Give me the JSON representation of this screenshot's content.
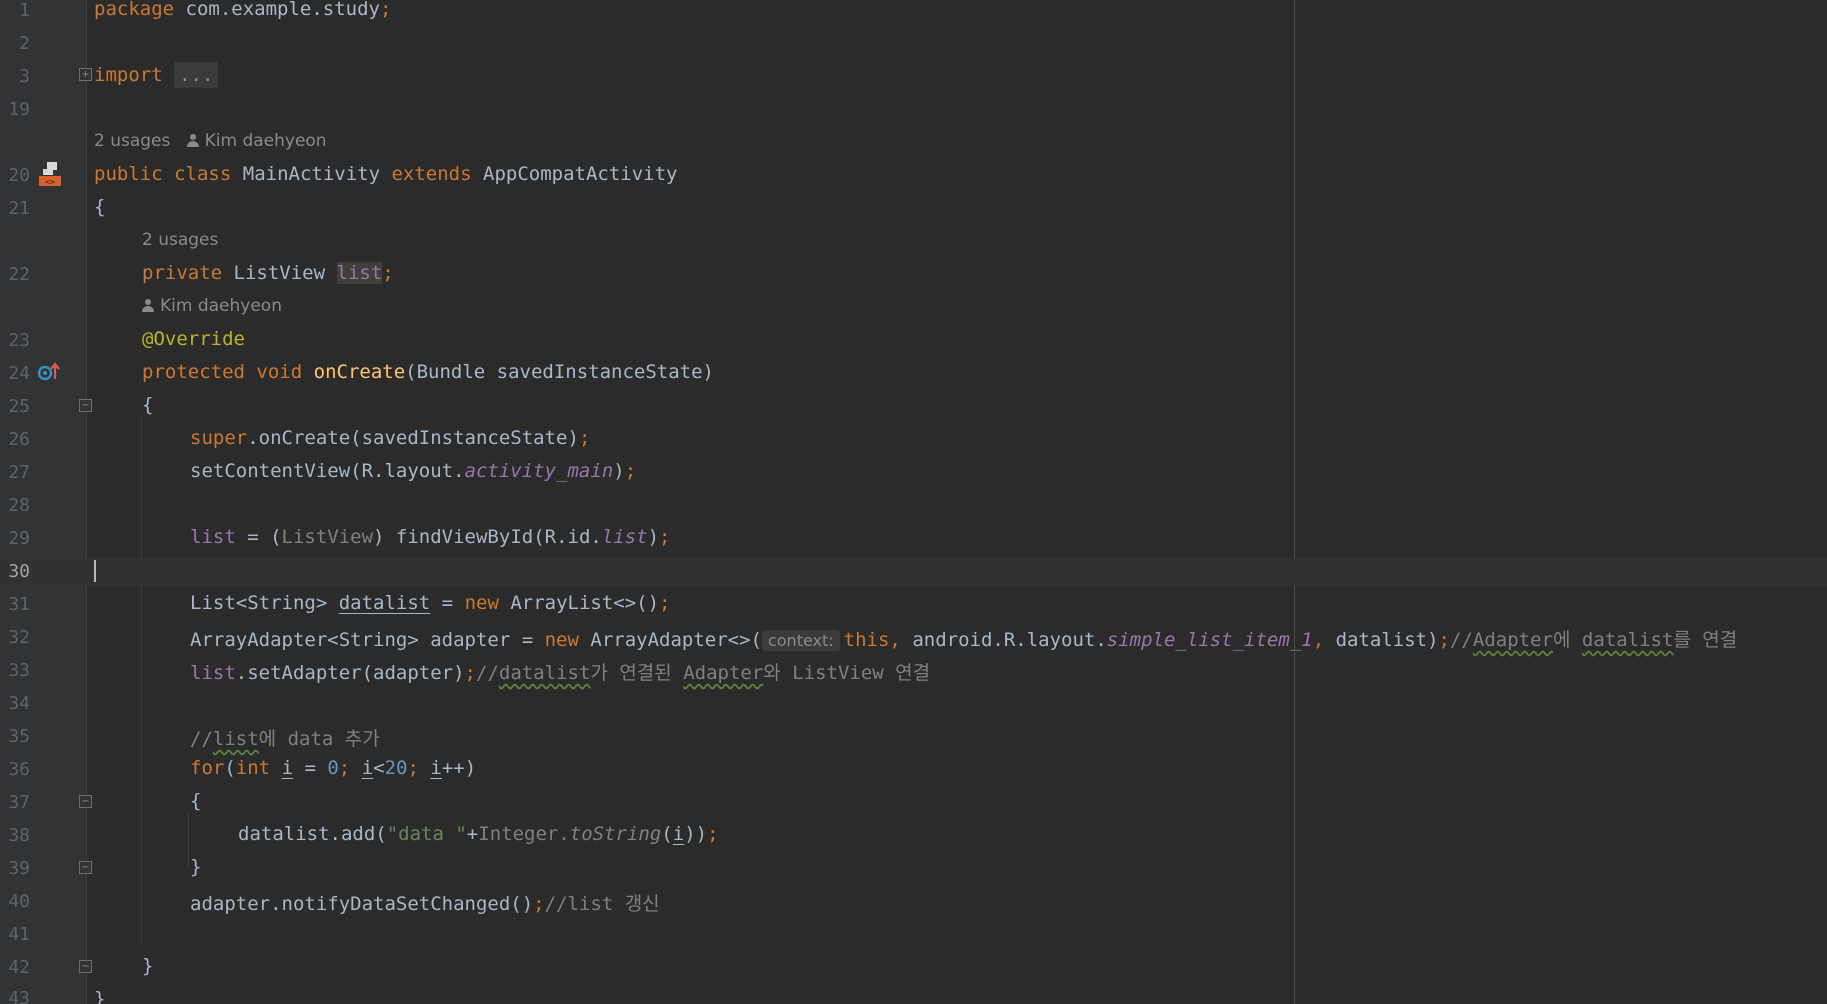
{
  "colors": {
    "background": "#2b2b2b",
    "keyword": "#cc7832",
    "method": "#ffc66d",
    "annotation": "#bbb529",
    "field": "#9876aa",
    "number": "#6897bb",
    "string": "#6a8759",
    "comment": "#808080"
  },
  "gutter": {
    "current_line": "30",
    "line_numbers": [
      "1",
      "2",
      "3",
      "19",
      "20",
      "21",
      "22",
      "23",
      "24",
      "25",
      "26",
      "27",
      "28",
      "29",
      "30",
      "31",
      "32",
      "33",
      "34",
      "35",
      "36",
      "37",
      "38",
      "39",
      "40",
      "41",
      "42",
      "43"
    ],
    "icons": [
      "layout-file-icon",
      "override-method-icon"
    ]
  },
  "hints": {
    "usages_class": "2 usages",
    "author_class": "Kim daehyeon",
    "usages_field": "2 usages",
    "author_method": "Kim daehyeon",
    "param_context": "context:"
  },
  "code": {
    "l1_kw": "package",
    "l1_rest": " com.example.study",
    "l1_semi": ";",
    "l3_kw": "import",
    "l3_fold": "...",
    "l20_kw1": "public",
    "l20_kw2": "class",
    "l20_name": "MainActivity",
    "l20_kw3": "extends",
    "l20_super": "AppCompatActivity",
    "l21": "{",
    "l22_kw": "private",
    "l22_type": "ListView",
    "l22_field": "list",
    "l22_semi": ";",
    "l23_ann": "@Override",
    "l24_kw1": "protected",
    "l24_kw2": "void",
    "l24_fn": "onCreate",
    "l24_rest": "(Bundle savedInstanceState)",
    "l25": "{",
    "l26_kw": "super",
    "l26_rest": ".onCreate(savedInstanceState)",
    "l26_semi": ";",
    "l27_a": "setContentView(R.layout.",
    "l27_field": "activity_main",
    "l27_b": ")",
    "l27_semi": ";",
    "l29_var": "list",
    "l29_a": " = (",
    "l29_cast": "ListView",
    "l29_b": ") findViewById(R.id.",
    "l29_field": "list",
    "l29_c": ")",
    "l29_semi": ";",
    "l31_a": "List<String> ",
    "l31_var": "datalist",
    "l31_b": " = ",
    "l31_kw": "new",
    "l31_c": " ArrayList<>()",
    "l31_semi": ";",
    "l32_a": "ArrayAdapter<String> adapter = ",
    "l32_kw": "new",
    "l32_b": " ArrayAdapter<>(",
    "l32_this": "this,",
    "l32_c": " android.R.layout.",
    "l32_field": "simple_list_item_1",
    "l32_comma": ",",
    "l32_d": " datalist)",
    "l32_semi": ";",
    "l32_cmt1": "//",
    "l32_cmt2": "Adapter",
    "l32_cmt3": "에 ",
    "l32_cmt4": "datalist",
    "l32_cmt5": "를 연결",
    "l33_var": "list",
    "l33_a": ".setAdapter(adapter)",
    "l33_semi": ";",
    "l33_cmt1": "//",
    "l33_cmt2": "datalist",
    "l33_cmt3": "가 연결된 ",
    "l33_cmt4": "Adapter",
    "l33_cmt5": "와 ListView 연결",
    "l35_cmt1": "//",
    "l35_cmt2": "list",
    "l35_cmt3": "에 data 추가",
    "l36_kw": "for",
    "l36_a": "(",
    "l36_kw2": "int",
    "l36_i1": "i",
    "l36_b": " = ",
    "l36_n0": "0",
    "l36_s1": ";",
    "l36_i2": "i",
    "l36_lt": "<",
    "l36_n20": "20",
    "l36_s2": ";",
    "l36_i3": "i",
    "l36_c": "++)",
    "l37": "{",
    "l38_a": "datalist.add(",
    "l38_str": "\"data \"",
    "l38_b": "+",
    "l38_cls": "Integer.",
    "l38_fn": "toString",
    "l38_c": "(",
    "l38_i": "i",
    "l38_d": "))",
    "l38_semi": ";",
    "l39": "}",
    "l40_a": "adapter.notifyDataSetChanged()",
    "l40_semi": ";",
    "l40_cmt": "//list 갱신",
    "l42": "}",
    "l43": "}"
  }
}
